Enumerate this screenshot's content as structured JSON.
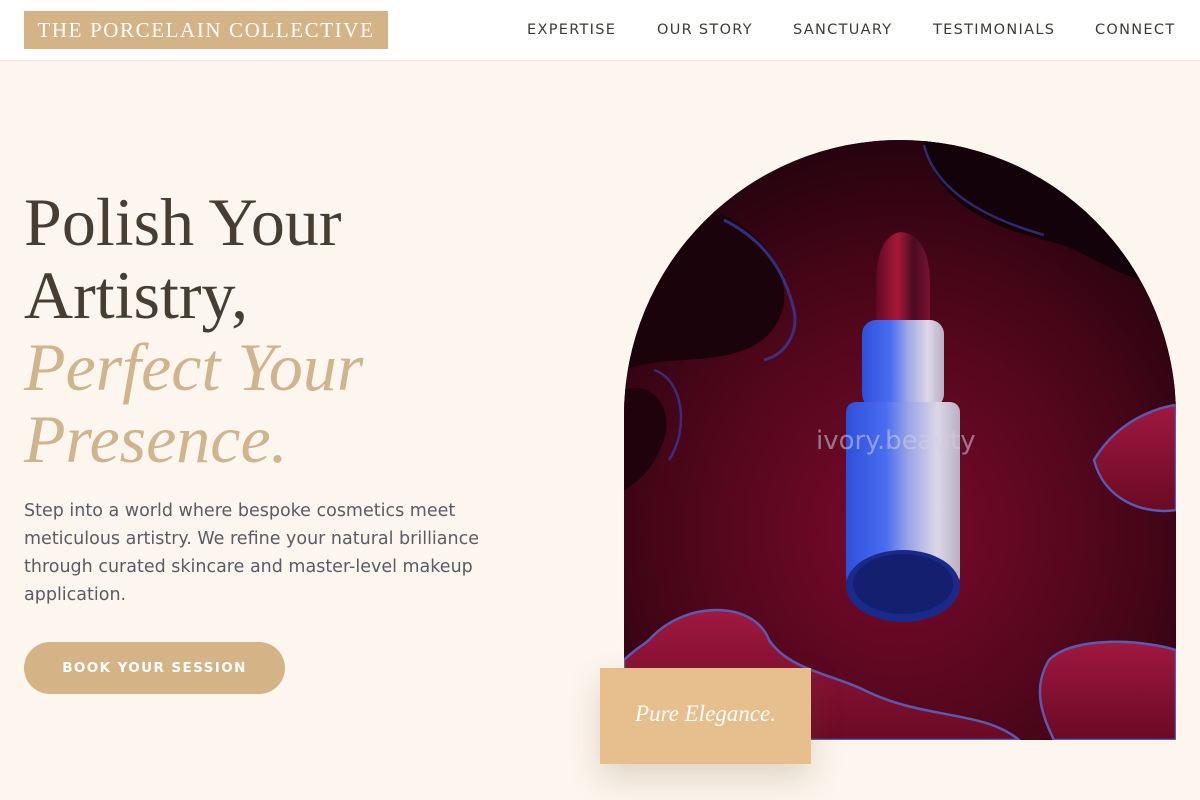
{
  "header": {
    "brand": "THE PORCELAIN COLLECTIVE",
    "nav": [
      "EXPERTISE",
      "OUR STORY",
      "SANCTUARY",
      "TESTIMONIALS",
      "CONNECT"
    ]
  },
  "hero": {
    "title_line1": "Polish Your",
    "title_line2": "Artistry,",
    "title_line3": "Perfect Your",
    "title_line4": "Presence.",
    "description": "Step into a world where bespoke cosmetics meet meticulous artistry. We refine your natural brilliance through curated skincare and master-level makeup application.",
    "cta_label": "BOOK YOUR SESSION"
  },
  "media": {
    "watermark": "ivory.beauty",
    "badge": "Pure Elegance."
  },
  "colors": {
    "accent": "#d4b486",
    "badge": "#e6bf8c",
    "background": "#fdf6ee",
    "heading_dark": "#473d33",
    "heading_gold": "#cfb48d"
  }
}
